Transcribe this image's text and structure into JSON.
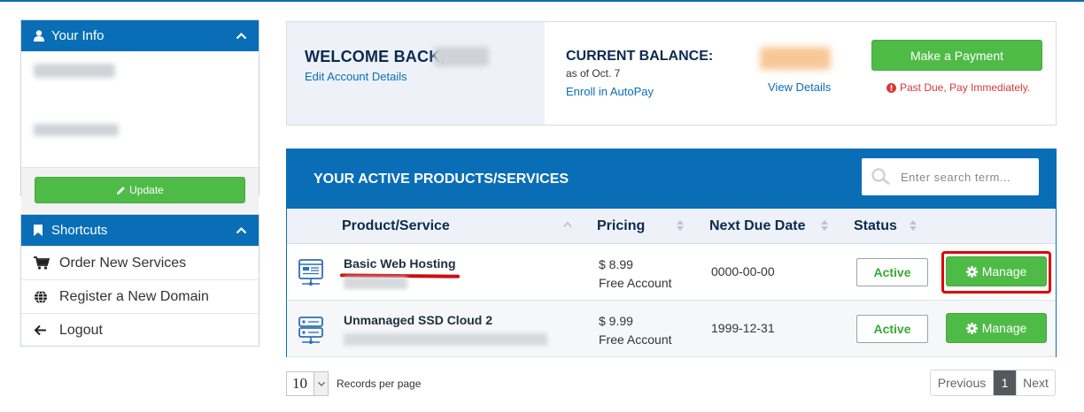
{
  "sidebar": {
    "your_info": {
      "title": "Your Info",
      "update_label": "Update"
    },
    "shortcuts": {
      "title": "Shortcuts",
      "items": [
        {
          "label": "Order New Services",
          "icon": "cart-icon"
        },
        {
          "label": "Register a New Domain",
          "icon": "globe-icon"
        },
        {
          "label": "Logout",
          "icon": "arrow-left-icon"
        }
      ]
    }
  },
  "welcome": {
    "greeting": "WELCOME BACK,",
    "edit_link": "Edit Account Details",
    "balance_label": "CURRENT BALANCE:",
    "as_of": "as of Oct. 7",
    "autopay_link": "Enroll in AutoPay",
    "view_details": "View Details",
    "pay_button": "Make a Payment",
    "past_due": "Past Due, Pay Immediately."
  },
  "products": {
    "title": "YOUR ACTIVE PRODUCTS/SERVICES",
    "search_placeholder": "Enter search term...",
    "columns": {
      "product": "Product/Service",
      "pricing": "Pricing",
      "due": "Next Due Date",
      "status": "Status"
    },
    "rows": [
      {
        "name": "Basic Web Hosting",
        "price": "$ 8.99",
        "billing": "Free Account",
        "due": "0000-00-00",
        "status": "Active",
        "action": "Manage"
      },
      {
        "name": "Unmanaged SSD Cloud 2",
        "price": "$ 9.99",
        "billing": "Free Account",
        "due": "1999-12-31",
        "status": "Active",
        "action": "Manage"
      }
    ]
  },
  "pagination": {
    "per_page_value": "10",
    "per_page_label": "Records per page",
    "previous": "Previous",
    "current": "1",
    "next": "Next"
  },
  "colors": {
    "primary": "#0a6eb7",
    "success": "#4fbb47",
    "danger": "#d63939"
  }
}
